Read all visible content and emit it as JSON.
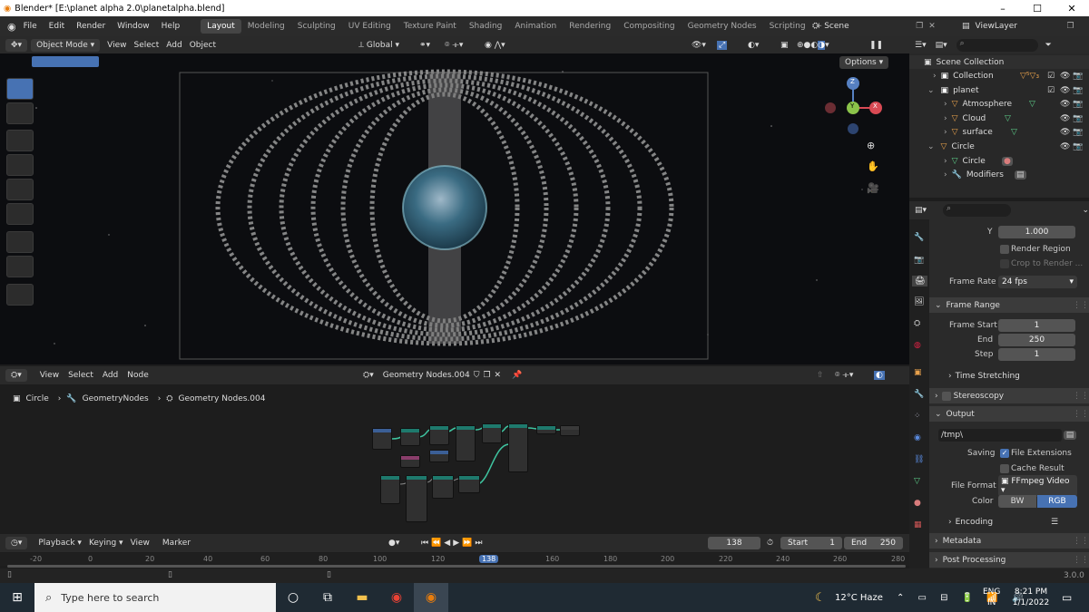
{
  "window": {
    "title": "Blender* [E:\\planet alpha 2.0\\planetalpha.blend]",
    "minimize": "–",
    "maximize": "☐",
    "close": "✕"
  },
  "menu": [
    "File",
    "Edit",
    "Render",
    "Window",
    "Help"
  ],
  "workspace_tabs": [
    "Layout",
    "Modeling",
    "Sculpting",
    "UV Editing",
    "Texture Paint",
    "Shading",
    "Animation",
    "Rendering",
    "Compositing",
    "Geometry Nodes",
    "Scripting"
  ],
  "scene": "Scene",
  "view_layer": "ViewLayer",
  "viewport": {
    "mode": "Object Mode",
    "menus": [
      "View",
      "Select",
      "Add",
      "Object"
    ],
    "orientation": "Global",
    "options": "Options",
    "gizmo": {
      "z": "Z",
      "y": "Y",
      "x": "X"
    }
  },
  "outliner": {
    "rows": [
      {
        "label": "Scene Collection",
        "indent": 0
      },
      {
        "label": "Collection",
        "indent": 1
      },
      {
        "label": "planet",
        "indent": 1
      },
      {
        "label": "Atmosphere",
        "indent": 2
      },
      {
        "label": "Cloud",
        "indent": 2
      },
      {
        "label": "surface",
        "indent": 2
      },
      {
        "label": "Circle",
        "indent": 1
      },
      {
        "label": "Circle",
        "indent": 2
      },
      {
        "label": "Modifiers",
        "indent": 2
      }
    ]
  },
  "props": {
    "y_label": "Y",
    "y_value": "1.000",
    "render_region": "Render Region",
    "crop": "Crop to Render ...",
    "frame_rate_label": "Frame Rate",
    "frame_rate": "24 fps",
    "frame_range": "Frame Range",
    "frame_start_label": "Frame Start",
    "frame_start": "1",
    "end_label": "End",
    "end": "250",
    "step_label": "Step",
    "step": "1",
    "time_stretching": "Time Stretching",
    "stereoscopy": "Stereoscopy",
    "output": "Output",
    "path": "/tmp\\",
    "saving": "Saving",
    "file_ext": "File Extensions",
    "cache": "Cache Result",
    "file_format_label": "File Format",
    "file_format": "FFmpeg Video",
    "color_label": "Color",
    "bw": "BW",
    "rgb": "RGB",
    "encoding": "Encoding",
    "metadata": "Metadata",
    "post": "Post Processing"
  },
  "node_editor": {
    "menus": [
      "View",
      "Select",
      "Add",
      "Node"
    ],
    "tree": "Geometry Nodes.004",
    "breadcrumb": [
      "Circle",
      "GeometryNodes",
      "Geometry Nodes.004"
    ]
  },
  "timeline": {
    "menus": [
      "Playback",
      "Keying",
      "View",
      "Marker"
    ],
    "current": "138",
    "start_label": "Start",
    "start": "1",
    "end_label": "End",
    "end": "250",
    "ticks": [
      "-20",
      "0",
      "20",
      "40",
      "60",
      "80",
      "100",
      "120",
      "138",
      "160",
      "180",
      "200",
      "220",
      "240",
      "260",
      "280"
    ]
  },
  "status": {
    "version": "3.0.0"
  },
  "taskbar": {
    "search": "Type here to search",
    "weather": "12°C Haze",
    "lang1": "ENG",
    "lang2": "IN",
    "time": "8:21 PM",
    "date": "1/1/2022"
  }
}
